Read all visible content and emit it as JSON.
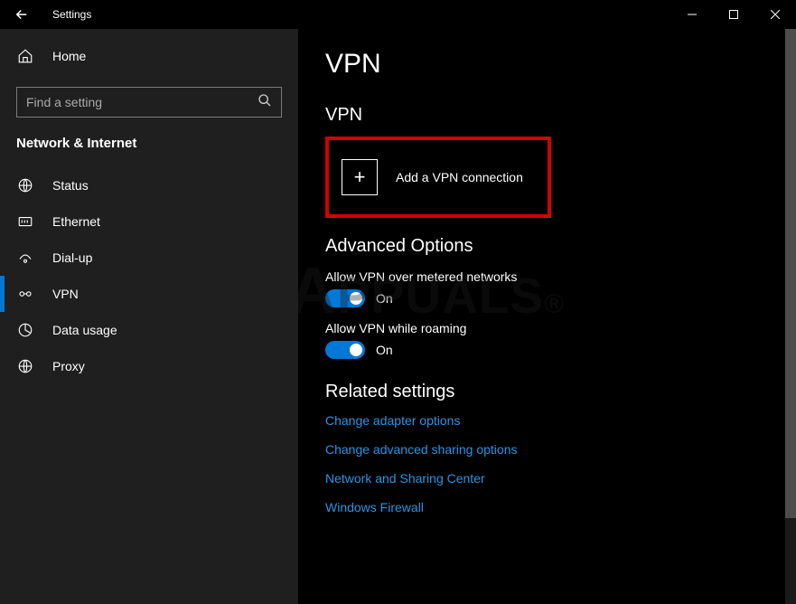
{
  "titlebar": {
    "app_title": "Settings"
  },
  "sidebar": {
    "home_label": "Home",
    "search_placeholder": "Find a setting",
    "category_header": "Network & Internet",
    "items": [
      {
        "label": "Status"
      },
      {
        "label": "Ethernet"
      },
      {
        "label": "Dial-up"
      },
      {
        "label": "VPN"
      },
      {
        "label": "Data usage"
      },
      {
        "label": "Proxy"
      }
    ]
  },
  "content": {
    "page_title": "VPN",
    "section_title": "VPN",
    "add_vpn_label": "Add a VPN connection",
    "advanced_header": "Advanced Options",
    "opt_metered_label": "Allow VPN over metered networks",
    "opt_metered_state": "On",
    "opt_roaming_label": "Allow VPN while roaming",
    "opt_roaming_state": "On",
    "related_header": "Related settings",
    "links": [
      "Change adapter options",
      "Change advanced sharing options",
      "Network and Sharing Center",
      "Windows Firewall"
    ]
  },
  "watermark": "PPUALS"
}
